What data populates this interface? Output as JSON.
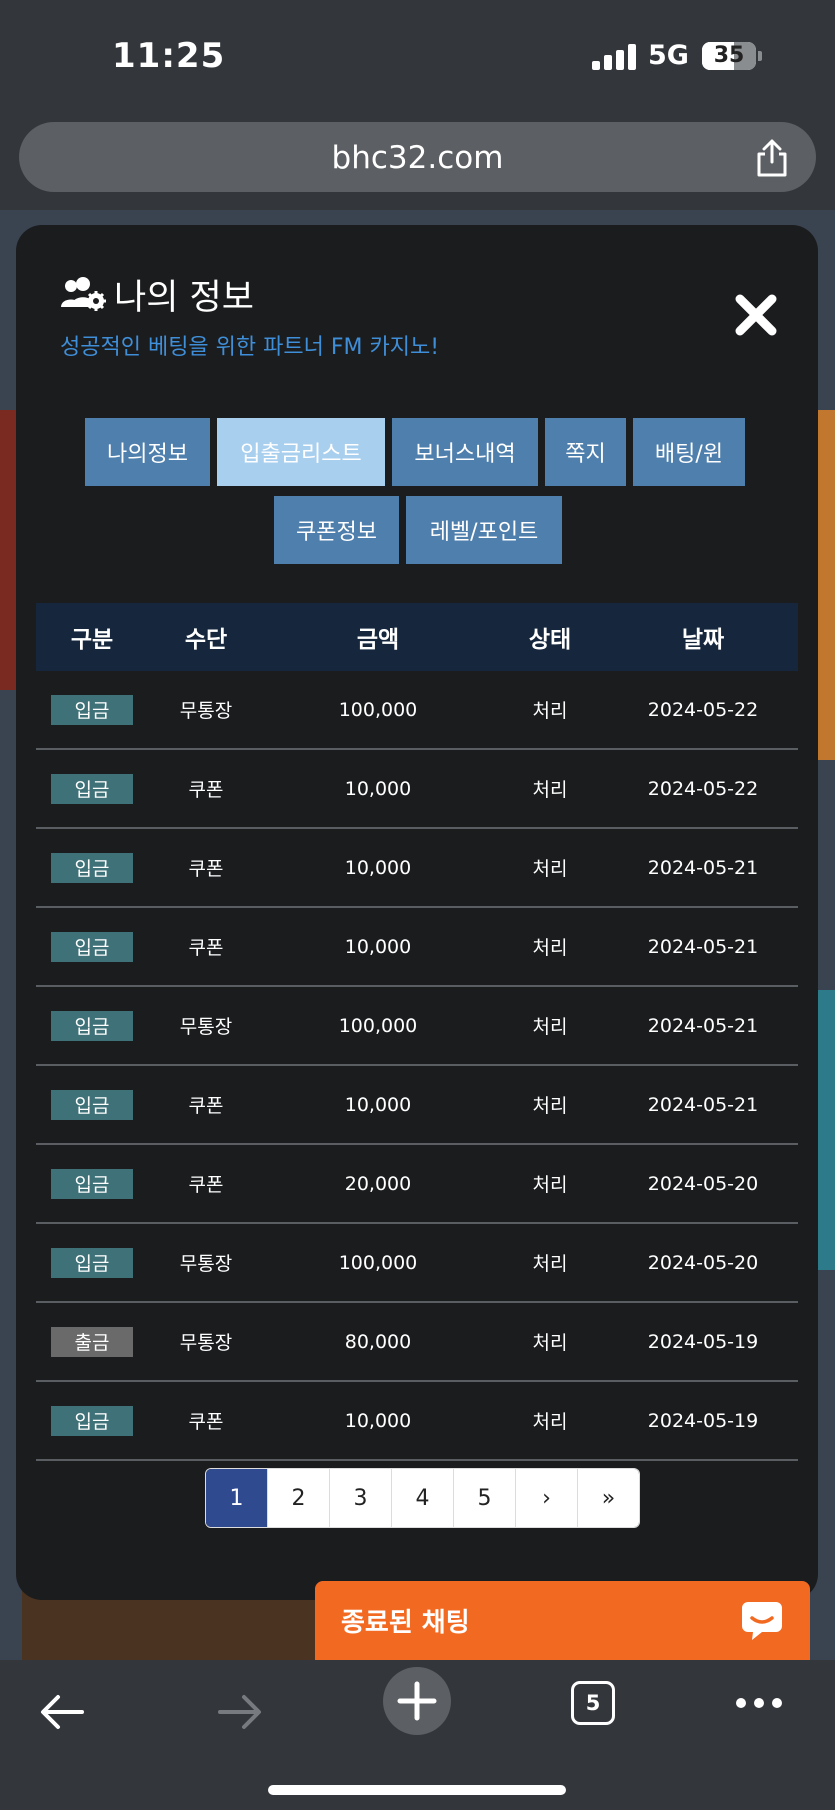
{
  "status": {
    "time": "11:25",
    "network": "5G",
    "battery": "35"
  },
  "browser": {
    "url": "bhc32.com",
    "tab_count": "5"
  },
  "modal": {
    "title": "나의 정보",
    "subtitle": "성공적인 베팅을 위한 파트너 FM 카지노!",
    "tabs_row1": [
      "나의정보",
      "입출금리스트",
      "보너스내역",
      "쪽지",
      "배팅/윈"
    ],
    "tabs_row2": [
      "쿠폰정보",
      "레벨/포인트"
    ],
    "active_tab": "입출금리스트"
  },
  "table": {
    "headers": [
      "구분",
      "수단",
      "금액",
      "상태",
      "날짜"
    ],
    "rows": [
      {
        "type": "입금",
        "method": "무통장",
        "amount": "100,000",
        "status": "처리",
        "date": "2024-05-22"
      },
      {
        "type": "입금",
        "method": "쿠폰",
        "amount": "10,000",
        "status": "처리",
        "date": "2024-05-22"
      },
      {
        "type": "입금",
        "method": "쿠폰",
        "amount": "10,000",
        "status": "처리",
        "date": "2024-05-21"
      },
      {
        "type": "입금",
        "method": "쿠폰",
        "amount": "10,000",
        "status": "처리",
        "date": "2024-05-21"
      },
      {
        "type": "입금",
        "method": "무통장",
        "amount": "100,000",
        "status": "처리",
        "date": "2024-05-21"
      },
      {
        "type": "입금",
        "method": "쿠폰",
        "amount": "10,000",
        "status": "처리",
        "date": "2024-05-21"
      },
      {
        "type": "입금",
        "method": "쿠폰",
        "amount": "20,000",
        "status": "처리",
        "date": "2024-05-20"
      },
      {
        "type": "입금",
        "method": "무통장",
        "amount": "100,000",
        "status": "처리",
        "date": "2024-05-20"
      },
      {
        "type": "출금",
        "method": "무통장",
        "amount": "80,000",
        "status": "처리",
        "date": "2024-05-19"
      },
      {
        "type": "입금",
        "method": "쿠폰",
        "amount": "10,000",
        "status": "처리",
        "date": "2024-05-19"
      }
    ]
  },
  "pagination": {
    "pages": [
      "1",
      "2",
      "3",
      "4",
      "5"
    ],
    "next": "›",
    "last": "»",
    "current": "1"
  },
  "chat": {
    "label": "종료된 채팅"
  },
  "colors": {
    "deposit_badge": "#3f7178",
    "withdraw_badge": "#6a6a6a",
    "tab": "#4f7fac",
    "tab_active": "#a9cfee",
    "chat": "#f26a22",
    "table_header": "#15263d",
    "pager_active": "#2f4a8f"
  }
}
